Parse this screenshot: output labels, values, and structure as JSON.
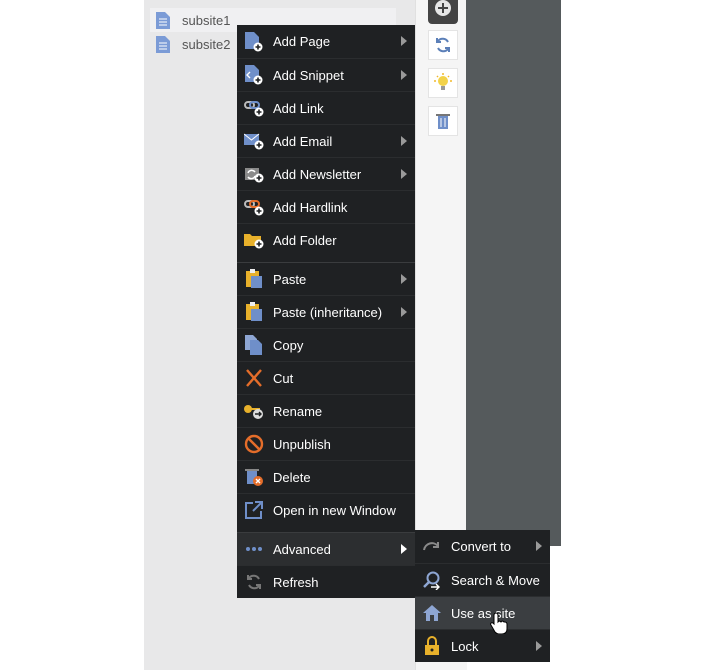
{
  "tree": {
    "items": [
      {
        "label": "subsite1"
      },
      {
        "label": "subsite2"
      }
    ]
  },
  "menu": {
    "items": [
      {
        "label": "Add Page",
        "icon": "page-add-icon",
        "has_submenu": true
      },
      {
        "label": "Add Snippet",
        "icon": "snippet-add-icon",
        "has_submenu": true
      },
      {
        "label": "Add Link",
        "icon": "link-add-icon",
        "has_submenu": false
      },
      {
        "label": "Add Email",
        "icon": "email-add-icon",
        "has_submenu": true
      },
      {
        "label": "Add Newsletter",
        "icon": "newsletter-add-icon",
        "has_submenu": true
      },
      {
        "label": "Add Hardlink",
        "icon": "hardlink-add-icon",
        "has_submenu": false
      },
      {
        "label": "Add Folder",
        "icon": "folder-add-icon",
        "has_submenu": false
      },
      {
        "label": "Paste",
        "icon": "paste-icon",
        "has_submenu": true
      },
      {
        "label": "Paste (inheritance)",
        "icon": "paste-inheritance-icon",
        "has_submenu": true
      },
      {
        "label": "Copy",
        "icon": "copy-icon",
        "has_submenu": false
      },
      {
        "label": "Cut",
        "icon": "cut-icon",
        "has_submenu": false
      },
      {
        "label": "Rename",
        "icon": "rename-icon",
        "has_submenu": false
      },
      {
        "label": "Unpublish",
        "icon": "unpublish-icon",
        "has_submenu": false
      },
      {
        "label": "Delete",
        "icon": "delete-icon",
        "has_submenu": false
      },
      {
        "label": "Open in new Window",
        "icon": "open-window-icon",
        "has_submenu": false
      },
      {
        "label": "Advanced",
        "icon": "more-icon",
        "has_submenu": true
      },
      {
        "label": "Refresh",
        "icon": "refresh-icon",
        "has_submenu": false
      }
    ]
  },
  "submenu": {
    "items": [
      {
        "label": "Convert to",
        "icon": "convert-icon",
        "has_submenu": true
      },
      {
        "label": "Search & Move",
        "icon": "search-move-icon",
        "has_submenu": false
      },
      {
        "label": "Use as site",
        "icon": "home-icon",
        "has_submenu": false
      },
      {
        "label": "Lock",
        "icon": "lock-icon",
        "has_submenu": true
      }
    ]
  },
  "colors": {
    "menu_bg": "#1f2123",
    "icon_blue": "#6f8fc9",
    "icon_orange": "#e46d2a",
    "icon_gold": "#e8b12b"
  }
}
